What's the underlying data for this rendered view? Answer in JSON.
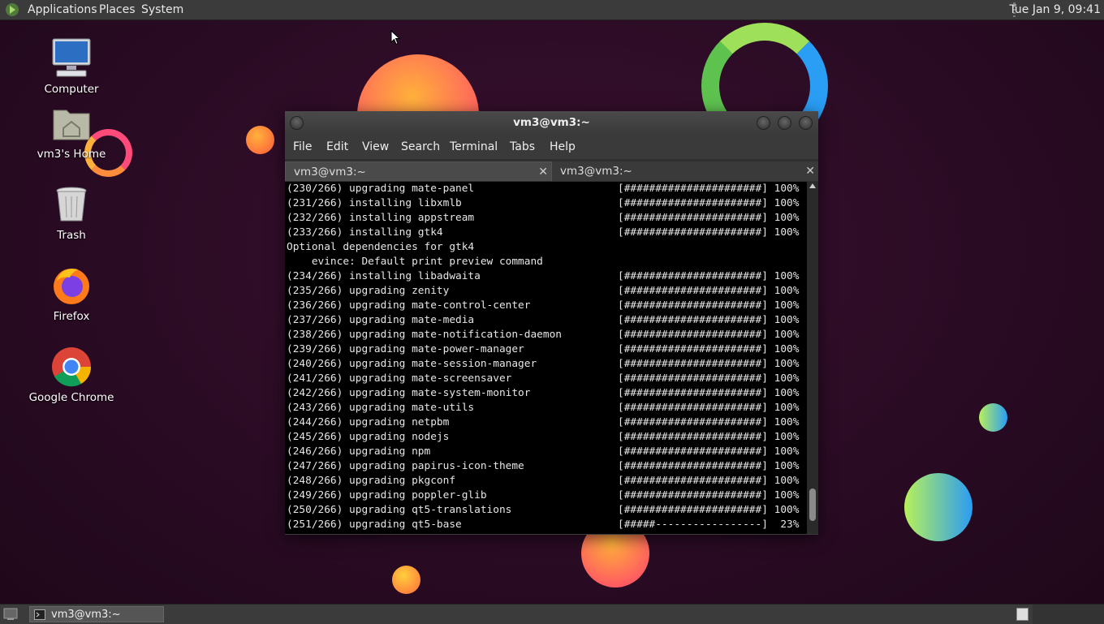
{
  "top_panel": {
    "menus": [
      "Applications",
      "Places",
      "System"
    ],
    "clock": "Tue Jan  9, 09:41"
  },
  "desktop_icons": [
    {
      "label": "Computer",
      "icon": "computer-icon"
    },
    {
      "label": "vm3's Home",
      "icon": "home-folder-icon"
    },
    {
      "label": "Trash",
      "icon": "trash-icon"
    },
    {
      "label": "Firefox",
      "icon": "firefox-icon"
    },
    {
      "label": "Google Chrome",
      "icon": "chrome-icon"
    }
  ],
  "terminal": {
    "title": "vm3@vm3:~",
    "menus": [
      "File",
      "Edit",
      "View",
      "Search",
      "Terminal",
      "Tabs",
      "Help"
    ],
    "tabs": [
      {
        "label": "vm3@vm3:~",
        "active": true
      },
      {
        "label": "vm3@vm3:~",
        "active": false
      }
    ],
    "lines": [
      {
        "text": "(230/266) upgrading mate-panel",
        "bar": "[######################] 100%"
      },
      {
        "text": "(231/266) installing libxmlb",
        "bar": "[######################] 100%"
      },
      {
        "text": "(232/266) installing appstream",
        "bar": "[######################] 100%"
      },
      {
        "text": "(233/266) installing gtk4",
        "bar": "[######################] 100%"
      },
      {
        "text": "Optional dependencies for gtk4",
        "bar": ""
      },
      {
        "text": "    evince: Default print preview command",
        "bar": ""
      },
      {
        "text": "(234/266) installing libadwaita",
        "bar": "[######################] 100%"
      },
      {
        "text": "(235/266) upgrading zenity",
        "bar": "[######################] 100%"
      },
      {
        "text": "(236/266) upgrading mate-control-center",
        "bar": "[######################] 100%"
      },
      {
        "text": "(237/266) upgrading mate-media",
        "bar": "[######################] 100%"
      },
      {
        "text": "(238/266) upgrading mate-notification-daemon",
        "bar": "[######################] 100%"
      },
      {
        "text": "(239/266) upgrading mate-power-manager",
        "bar": "[######################] 100%"
      },
      {
        "text": "(240/266) upgrading mate-session-manager",
        "bar": "[######################] 100%"
      },
      {
        "text": "(241/266) upgrading mate-screensaver",
        "bar": "[######################] 100%"
      },
      {
        "text": "(242/266) upgrading mate-system-monitor",
        "bar": "[######################] 100%"
      },
      {
        "text": "(243/266) upgrading mate-utils",
        "bar": "[######################] 100%"
      },
      {
        "text": "(244/266) upgrading netpbm",
        "bar": "[######################] 100%"
      },
      {
        "text": "(245/266) upgrading nodejs",
        "bar": "[######################] 100%"
      },
      {
        "text": "(246/266) upgrading npm",
        "bar": "[######################] 100%"
      },
      {
        "text": "(247/266) upgrading papirus-icon-theme",
        "bar": "[######################] 100%"
      },
      {
        "text": "(248/266) upgrading pkgconf",
        "bar": "[######################] 100%"
      },
      {
        "text": "(249/266) upgrading poppler-glib",
        "bar": "[######################] 100%"
      },
      {
        "text": "(250/266) upgrading qt5-translations",
        "bar": "[######################] 100%"
      },
      {
        "text": "(251/266) upgrading qt5-base",
        "bar": "[#####-----------------]  23%"
      }
    ]
  },
  "taskbar": {
    "task_label": "vm3@vm3:~"
  },
  "colors": {
    "desktop_bg": "#2a0b24",
    "panel": "#3b3b3b",
    "terminal_bg": "#000000",
    "terminal_fg": "#e6e6e6"
  }
}
